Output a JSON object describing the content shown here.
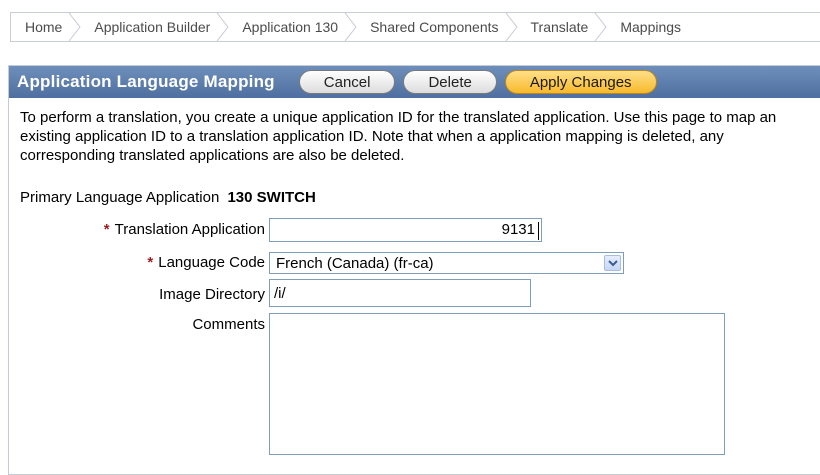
{
  "breadcrumb": {
    "items": [
      "Home",
      "Application Builder",
      "Application 130",
      "Shared Components",
      "Translate",
      "Mappings"
    ]
  },
  "region": {
    "title": "Application Language Mapping",
    "buttons": {
      "cancel": "Cancel",
      "delete": "Delete",
      "apply": "Apply Changes"
    },
    "instructions": "To perform a translation, you create a unique application ID for the translated application. Use this page to map an existing application ID to a translation application ID. Note that when a application mapping is deleted, any corresponding translated applications are also be deleted."
  },
  "form": {
    "primary_label": "Primary Language Application",
    "primary_value": "130 SWITCH",
    "required_marker": "*",
    "translation_label": "Translation Application",
    "translation_value": "9131",
    "language_label": "Language Code",
    "language_value": "French (Canada) (fr-ca)",
    "image_dir_label": "Image Directory",
    "image_dir_value": "/i/",
    "comments_label": "Comments",
    "comments_value": ""
  },
  "colors": {
    "header_bg": "#5d7dac",
    "primary_button": "#f8b92b",
    "required": "#9b1d1d"
  }
}
